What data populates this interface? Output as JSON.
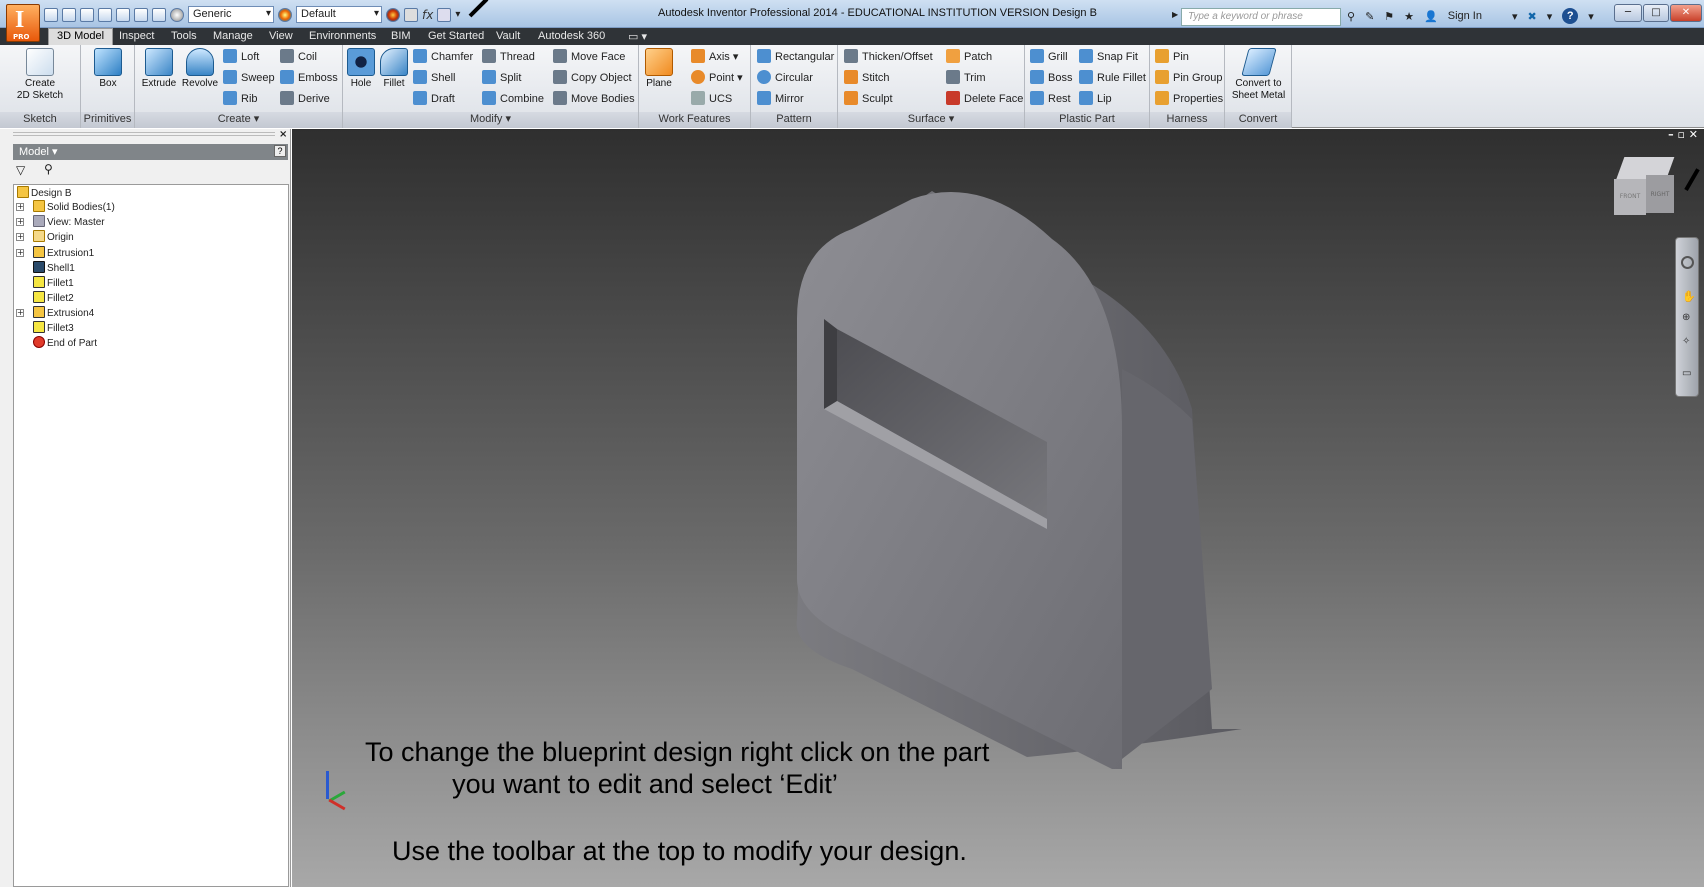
{
  "window": {
    "title": "Autodesk Inventor Professional 2014 - EDUCATIONAL INSTITUTION VERSION   Design B",
    "logo_letter": "I",
    "logo_badge": "PRO",
    "search_placeholder": "Type a keyword or phrase",
    "sign_in": "Sign In"
  },
  "qat": {
    "material": "Generic",
    "appearance": "Default",
    "fx": "fx"
  },
  "menu": [
    "3D Model",
    "Inspect",
    "Tools",
    "Manage",
    "View",
    "Environments",
    "BIM",
    "Get Started",
    "Vault",
    "Autodesk 360"
  ],
  "ribbon": {
    "sketch": {
      "create_2d": "Create\n2D Sketch",
      "label": "Sketch"
    },
    "primitives": {
      "box": "Box",
      "label": "Primitives"
    },
    "create": {
      "extrude": "Extrude",
      "revolve": "Revolve",
      "loft": "Loft",
      "sweep": "Sweep",
      "rib": "Rib",
      "coil": "Coil",
      "emboss": "Emboss",
      "derive": "Derive",
      "label": "Create ▾"
    },
    "modify": {
      "hole": "Hole",
      "fillet": "Fillet",
      "chamfer": "Chamfer",
      "shell": "Shell",
      "draft": "Draft",
      "thread": "Thread",
      "split": "Split",
      "combine": "Combine",
      "move_face": "Move Face",
      "copy_object": "Copy Object",
      "move_bodies": "Move Bodies",
      "label": "Modify ▾"
    },
    "work": {
      "plane": "Plane",
      "axis": "Axis ▾",
      "point": "Point ▾",
      "ucs": "UCS",
      "label": "Work Features"
    },
    "pattern": {
      "rectangular": "Rectangular",
      "circular": "Circular",
      "mirror": "Mirror",
      "label": "Pattern"
    },
    "surface": {
      "thicken": "Thicken/Offset",
      "stitch": "Stitch",
      "sculpt": "Sculpt",
      "patch": "Patch",
      "trim": "Trim",
      "delete_face": "Delete Face",
      "label": "Surface ▾"
    },
    "plastic": {
      "grill": "Grill",
      "boss": "Boss",
      "rest": "Rest",
      "snap_fit": "Snap Fit",
      "rule_fillet": "Rule Fillet",
      "lip": "Lip",
      "label": "Plastic Part"
    },
    "harness": {
      "pin": "Pin",
      "pin_group": "Pin Group",
      "properties": "Properties",
      "label": "Harness"
    },
    "convert": {
      "sheet_metal": "Convert to\nSheet Metal",
      "label": "Convert"
    }
  },
  "browser": {
    "header": "Model ▾",
    "tree": [
      "Design B",
      "Solid Bodies(1)",
      "View: Master",
      "Origin",
      "Extrusion1",
      "Shell1",
      "Fillet1",
      "Fillet2",
      "Extrusion4",
      "Fillet3",
      "End of Part"
    ]
  },
  "captions": {
    "line1": "To change the blueprint design right click on the part",
    "line2": "you want to edit and select ‘Edit’",
    "line3": "Use the toolbar at the top to modify your design."
  },
  "viewcube": {
    "front": "FRONT",
    "right": "RIGHT"
  }
}
